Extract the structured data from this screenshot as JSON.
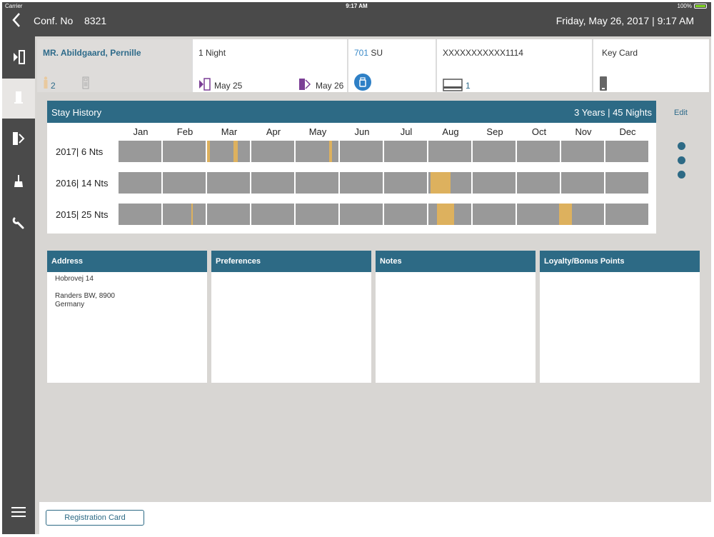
{
  "status_bar": {
    "carrier": "Carrier",
    "time": "9:17 AM",
    "battery": "100%"
  },
  "nav": {
    "back_icon": "chevron-left-icon",
    "conf_label": "Conf. No",
    "conf_number": "8321",
    "datetime": "Friday, May 26, 2017 | 9:17 AM"
  },
  "sidebar": {
    "items": [
      {
        "icon": "check-in-icon",
        "active": false
      },
      {
        "icon": "door-icon",
        "active": true
      },
      {
        "icon": "check-out-icon",
        "active": false
      },
      {
        "icon": "housekeeping-broom-icon",
        "active": false
      },
      {
        "icon": "wrench-icon",
        "active": false
      }
    ],
    "menu_icon": "menu-icon"
  },
  "reservation": {
    "guest_name": "MR. Abildgaard, Pernille",
    "guest_count": "2",
    "nights": "1 Night",
    "arrival": "May 25",
    "departure": "May 26",
    "room_number": "701",
    "room_type": "SU",
    "card_number": "XXXXXXXXXXX1114",
    "card_count": "1",
    "key_label": "Key Card"
  },
  "stay_history": {
    "title": "Stay History",
    "summary": "3 Years | 45 Nights",
    "edit_label": "Edit",
    "months": [
      "Jan",
      "Feb",
      "Mar",
      "Apr",
      "May",
      "Jun",
      "Jul",
      "Aug",
      "Sep",
      "Oct",
      "Nov",
      "Dec"
    ],
    "years": [
      {
        "label": "2017| 6 Nts",
        "stays": [
          {
            "start_month": 2.0,
            "days": 2
          },
          {
            "start_month": 2.6,
            "days": 3
          },
          {
            "start_month": 4.75,
            "days": 2
          }
        ]
      },
      {
        "label": "2016| 14 Nts",
        "stays": [
          {
            "start_month": 7.05,
            "days": 14
          }
        ]
      },
      {
        "label": "2015| 25 Nts",
        "stays": [
          {
            "start_month": 1.65,
            "days": 1
          },
          {
            "start_month": 7.2,
            "days": 12
          },
          {
            "start_month": 9.95,
            "days": 9
          }
        ]
      }
    ],
    "stay_color": "#ddb15e",
    "bar_color": "#999999"
  },
  "panels": [
    {
      "title": "Address",
      "lines": [
        "Hobrovej 14",
        "",
        "Randers BW, 8900",
        "Germany"
      ]
    },
    {
      "title": "Preferences",
      "lines": []
    },
    {
      "title": "Notes",
      "lines": []
    },
    {
      "title": "Loyalty/Bonus Points",
      "lines": []
    }
  ],
  "footer": {
    "registration_button": "Registration Card"
  },
  "colors": {
    "header_blue": "#2d6a85",
    "link_blue": "#2e6b8a",
    "nav_bg": "#4a4a4a",
    "content_bg": "#d8d6d3",
    "accent_purple": "#7b3f96"
  }
}
